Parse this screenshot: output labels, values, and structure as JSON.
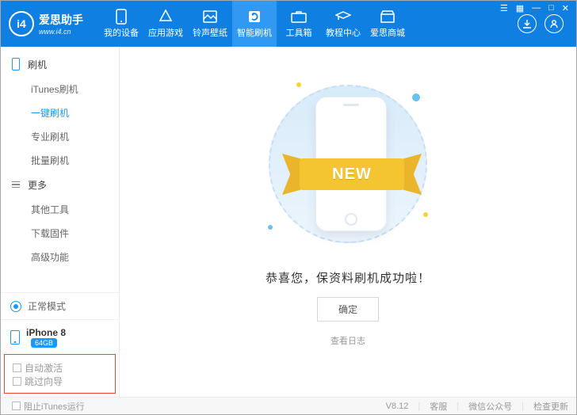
{
  "brand": {
    "name": "爱思助手",
    "site": "www.i4.cn"
  },
  "nav": {
    "items": [
      {
        "label": "我的设备"
      },
      {
        "label": "应用游戏"
      },
      {
        "label": "铃声壁纸"
      },
      {
        "label": "智能刷机"
      },
      {
        "label": "工具箱"
      },
      {
        "label": "教程中心"
      },
      {
        "label": "爱思商城"
      }
    ]
  },
  "sidebar": {
    "group1_title": "刷机",
    "items1": [
      {
        "label": "iTunes刷机"
      },
      {
        "label": "一键刷机"
      },
      {
        "label": "专业刷机"
      },
      {
        "label": "批量刷机"
      }
    ],
    "group2_title": "更多",
    "items2": [
      {
        "label": "其他工具"
      },
      {
        "label": "下载固件"
      },
      {
        "label": "高级功能"
      }
    ],
    "mode_label": "正常模式",
    "device_name": "iPhone 8",
    "storage_badge": "64GB",
    "chk_auto_activate": "自动激活",
    "chk_skip_guide": "跳过向导"
  },
  "main": {
    "ribbon_text": "NEW",
    "success_text": "恭喜您，保资料刷机成功啦！",
    "ok_button": "确定",
    "view_log": "查看日志"
  },
  "footer": {
    "block_itunes": "阻止iTunes运行",
    "version": "V8.12",
    "support": "客服",
    "wechat": "微信公众号",
    "check_update": "检查更新"
  }
}
